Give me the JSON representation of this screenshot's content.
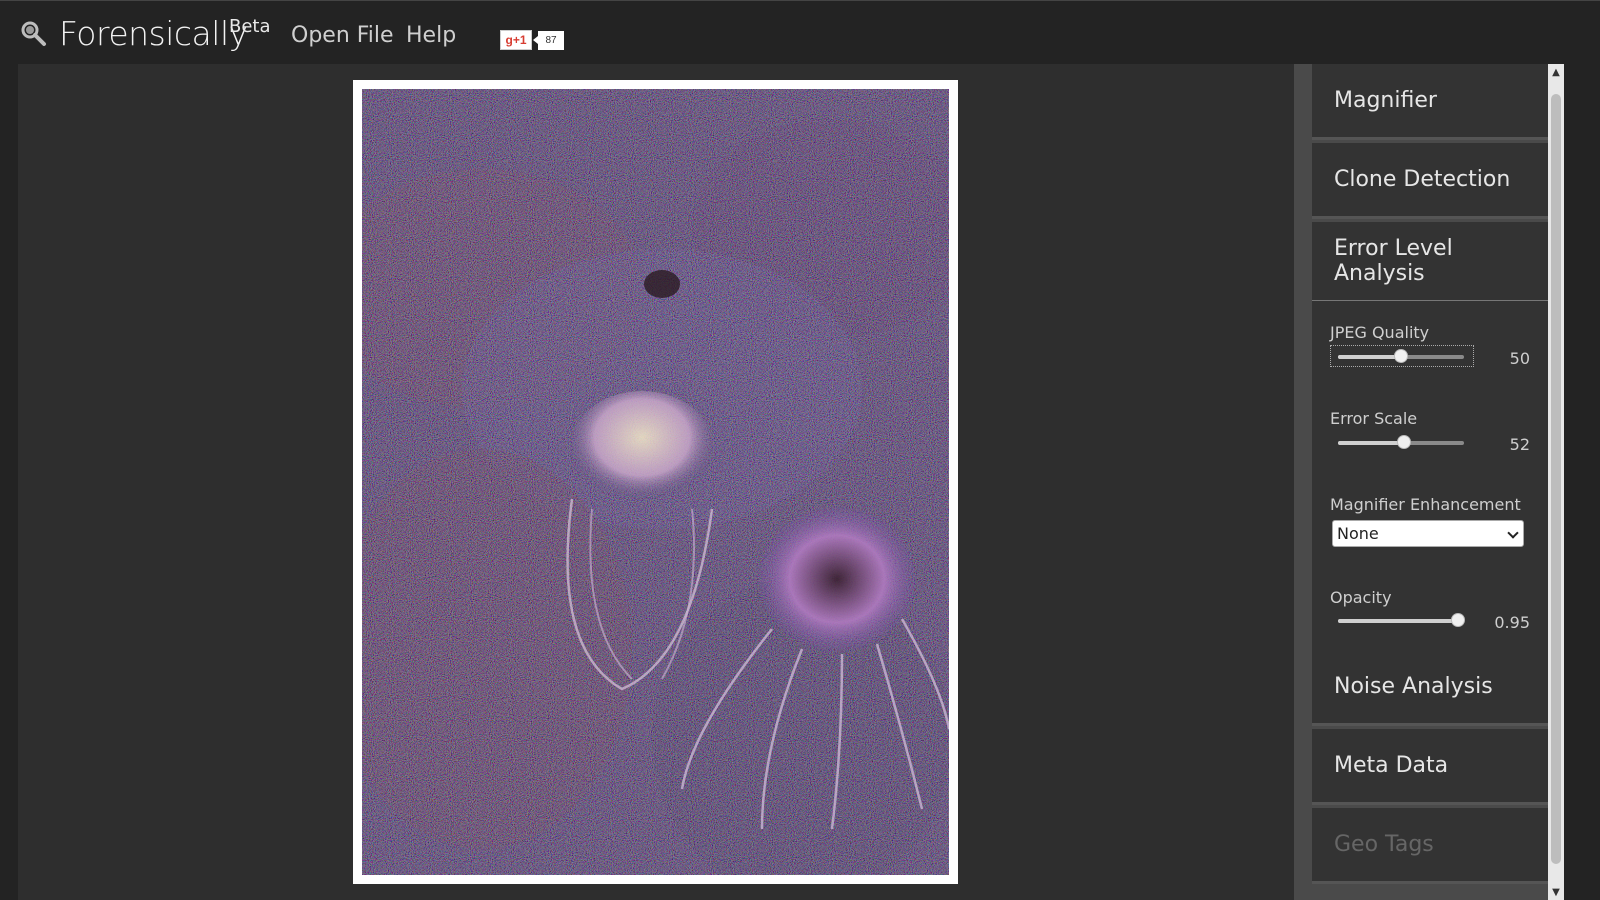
{
  "header": {
    "app_title": "Forensically",
    "beta_label": "Beta",
    "nav": [
      {
        "label": "Open File"
      },
      {
        "label": "Help"
      }
    ],
    "gplus_label": "g+1",
    "gplus_count": "87"
  },
  "sidebar": {
    "panels": [
      {
        "label": "Magnifier",
        "expanded": false,
        "enabled": true
      },
      {
        "label": "Clone Detection",
        "expanded": false,
        "enabled": true
      },
      {
        "label": "Error Level Analysis",
        "expanded": true,
        "enabled": true
      },
      {
        "label": "Noise Analysis",
        "expanded": false,
        "enabled": true
      },
      {
        "label": "Meta Data",
        "expanded": false,
        "enabled": true
      },
      {
        "label": "Geo Tags",
        "expanded": false,
        "enabled": false
      }
    ],
    "ela": {
      "jpeg_quality": {
        "label": "JPEG Quality",
        "value": "50",
        "fraction": 0.5
      },
      "error_scale": {
        "label": "Error Scale",
        "value": "52",
        "fraction": 0.52
      },
      "magnifier_enhancement": {
        "label": "Magnifier Enhancement",
        "selected": "None"
      },
      "opacity": {
        "label": "Opacity",
        "value": "0.95",
        "fraction": 0.95
      }
    }
  },
  "icons": {
    "logo": "magnifier-icon",
    "scroll_up": "chevron-up-icon",
    "scroll_down": "chevron-down-icon"
  },
  "colors": {
    "background": "#232323",
    "canvas": "#2e2e2e",
    "panel": "#333333",
    "sidebar": "#4a4a4a"
  }
}
